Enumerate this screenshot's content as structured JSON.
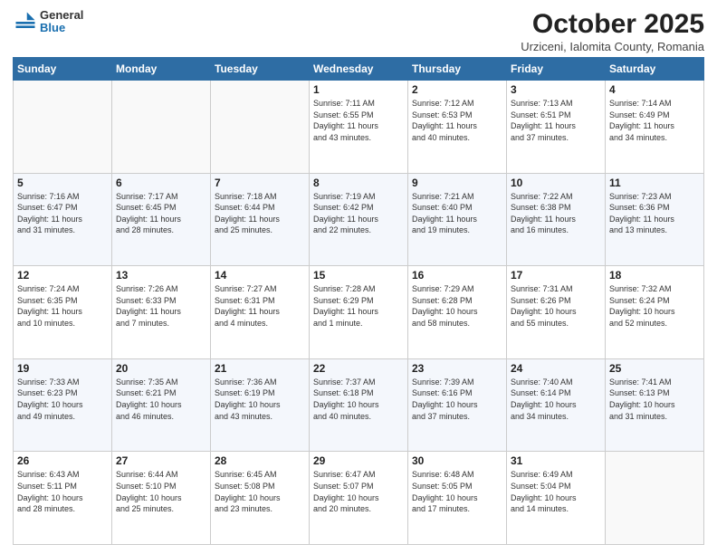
{
  "header": {
    "logo_general": "General",
    "logo_blue": "Blue",
    "title": "October 2025",
    "subtitle": "Urziceni, Ialomita County, Romania"
  },
  "weekdays": [
    "Sunday",
    "Monday",
    "Tuesday",
    "Wednesday",
    "Thursday",
    "Friday",
    "Saturday"
  ],
  "weeks": [
    [
      {
        "day": "",
        "info": ""
      },
      {
        "day": "",
        "info": ""
      },
      {
        "day": "",
        "info": ""
      },
      {
        "day": "1",
        "info": "Sunrise: 7:11 AM\nSunset: 6:55 PM\nDaylight: 11 hours\nand 43 minutes."
      },
      {
        "day": "2",
        "info": "Sunrise: 7:12 AM\nSunset: 6:53 PM\nDaylight: 11 hours\nand 40 minutes."
      },
      {
        "day": "3",
        "info": "Sunrise: 7:13 AM\nSunset: 6:51 PM\nDaylight: 11 hours\nand 37 minutes."
      },
      {
        "day": "4",
        "info": "Sunrise: 7:14 AM\nSunset: 6:49 PM\nDaylight: 11 hours\nand 34 minutes."
      }
    ],
    [
      {
        "day": "5",
        "info": "Sunrise: 7:16 AM\nSunset: 6:47 PM\nDaylight: 11 hours\nand 31 minutes."
      },
      {
        "day": "6",
        "info": "Sunrise: 7:17 AM\nSunset: 6:45 PM\nDaylight: 11 hours\nand 28 minutes."
      },
      {
        "day": "7",
        "info": "Sunrise: 7:18 AM\nSunset: 6:44 PM\nDaylight: 11 hours\nand 25 minutes."
      },
      {
        "day": "8",
        "info": "Sunrise: 7:19 AM\nSunset: 6:42 PM\nDaylight: 11 hours\nand 22 minutes."
      },
      {
        "day": "9",
        "info": "Sunrise: 7:21 AM\nSunset: 6:40 PM\nDaylight: 11 hours\nand 19 minutes."
      },
      {
        "day": "10",
        "info": "Sunrise: 7:22 AM\nSunset: 6:38 PM\nDaylight: 11 hours\nand 16 minutes."
      },
      {
        "day": "11",
        "info": "Sunrise: 7:23 AM\nSunset: 6:36 PM\nDaylight: 11 hours\nand 13 minutes."
      }
    ],
    [
      {
        "day": "12",
        "info": "Sunrise: 7:24 AM\nSunset: 6:35 PM\nDaylight: 11 hours\nand 10 minutes."
      },
      {
        "day": "13",
        "info": "Sunrise: 7:26 AM\nSunset: 6:33 PM\nDaylight: 11 hours\nand 7 minutes."
      },
      {
        "day": "14",
        "info": "Sunrise: 7:27 AM\nSunset: 6:31 PM\nDaylight: 11 hours\nand 4 minutes."
      },
      {
        "day": "15",
        "info": "Sunrise: 7:28 AM\nSunset: 6:29 PM\nDaylight: 11 hours\nand 1 minute."
      },
      {
        "day": "16",
        "info": "Sunrise: 7:29 AM\nSunset: 6:28 PM\nDaylight: 10 hours\nand 58 minutes."
      },
      {
        "day": "17",
        "info": "Sunrise: 7:31 AM\nSunset: 6:26 PM\nDaylight: 10 hours\nand 55 minutes."
      },
      {
        "day": "18",
        "info": "Sunrise: 7:32 AM\nSunset: 6:24 PM\nDaylight: 10 hours\nand 52 minutes."
      }
    ],
    [
      {
        "day": "19",
        "info": "Sunrise: 7:33 AM\nSunset: 6:23 PM\nDaylight: 10 hours\nand 49 minutes."
      },
      {
        "day": "20",
        "info": "Sunrise: 7:35 AM\nSunset: 6:21 PM\nDaylight: 10 hours\nand 46 minutes."
      },
      {
        "day": "21",
        "info": "Sunrise: 7:36 AM\nSunset: 6:19 PM\nDaylight: 10 hours\nand 43 minutes."
      },
      {
        "day": "22",
        "info": "Sunrise: 7:37 AM\nSunset: 6:18 PM\nDaylight: 10 hours\nand 40 minutes."
      },
      {
        "day": "23",
        "info": "Sunrise: 7:39 AM\nSunset: 6:16 PM\nDaylight: 10 hours\nand 37 minutes."
      },
      {
        "day": "24",
        "info": "Sunrise: 7:40 AM\nSunset: 6:14 PM\nDaylight: 10 hours\nand 34 minutes."
      },
      {
        "day": "25",
        "info": "Sunrise: 7:41 AM\nSunset: 6:13 PM\nDaylight: 10 hours\nand 31 minutes."
      }
    ],
    [
      {
        "day": "26",
        "info": "Sunrise: 6:43 AM\nSunset: 5:11 PM\nDaylight: 10 hours\nand 28 minutes."
      },
      {
        "day": "27",
        "info": "Sunrise: 6:44 AM\nSunset: 5:10 PM\nDaylight: 10 hours\nand 25 minutes."
      },
      {
        "day": "28",
        "info": "Sunrise: 6:45 AM\nSunset: 5:08 PM\nDaylight: 10 hours\nand 23 minutes."
      },
      {
        "day": "29",
        "info": "Sunrise: 6:47 AM\nSunset: 5:07 PM\nDaylight: 10 hours\nand 20 minutes."
      },
      {
        "day": "30",
        "info": "Sunrise: 6:48 AM\nSunset: 5:05 PM\nDaylight: 10 hours\nand 17 minutes."
      },
      {
        "day": "31",
        "info": "Sunrise: 6:49 AM\nSunset: 5:04 PM\nDaylight: 10 hours\nand 14 minutes."
      },
      {
        "day": "",
        "info": ""
      }
    ]
  ]
}
